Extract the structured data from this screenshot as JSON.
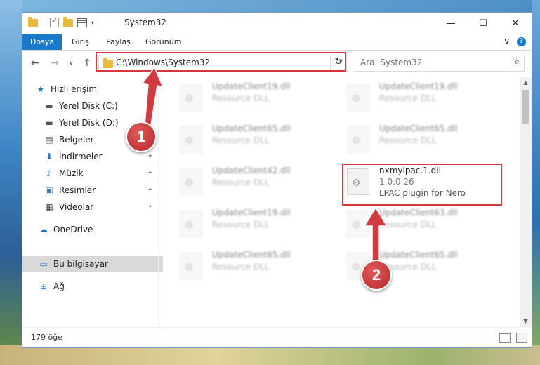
{
  "window": {
    "title": "System32",
    "minimize_glyph": "—",
    "maximize_glyph": "☐",
    "close_glyph": "✕"
  },
  "ribbon": {
    "tabs": [
      "Dosya",
      "Giriş",
      "Paylaş",
      "Görünüm"
    ],
    "expand_glyph": "∨",
    "help_glyph": "?"
  },
  "navigation": {
    "back_glyph": "←",
    "forward_glyph": "→",
    "recent_glyph": "∨",
    "up_glyph": "↑",
    "address_path": "C:\\Windows\\System32",
    "address_dropdown_glyph": "∨",
    "refresh_glyph": "↻",
    "search_placeholder": "Ara: System32",
    "search_glyph": "⌕"
  },
  "sidebar": {
    "items": [
      {
        "label": "Hızlı erişim",
        "icon": "star-icon",
        "glyph": "★",
        "pinned": false
      },
      {
        "label": "Yerel Disk (C:)",
        "icon": "drive-icon",
        "glyph": "▬",
        "pinned": true
      },
      {
        "label": "Yerel Disk (D:)",
        "icon": "drive-icon",
        "glyph": "▬",
        "pinned": true
      },
      {
        "label": "Belgeler",
        "icon": "documents-icon",
        "glyph": "▤",
        "pinned": true
      },
      {
        "label": "İndirmeler",
        "icon": "download-icon",
        "glyph": "⬇",
        "pinned": true
      },
      {
        "label": "Müzik",
        "icon": "music-icon",
        "glyph": "♪",
        "pinned": true
      },
      {
        "label": "Resimler",
        "icon": "pictures-icon",
        "glyph": "▣",
        "pinned": true
      },
      {
        "label": "Videolar",
        "icon": "video-icon",
        "glyph": "▦",
        "pinned": true
      },
      {
        "label": "OneDrive",
        "icon": "cloud-icon",
        "glyph": "☁",
        "pinned": false
      },
      {
        "label": "Bu bilgisayar",
        "icon": "computer-icon",
        "glyph": "▭",
        "pinned": false
      },
      {
        "label": "Ağ",
        "icon": "network-icon",
        "glyph": "⊞",
        "pinned": false
      }
    ],
    "pin_glyph": "📌"
  },
  "files": {
    "left_column": [
      {
        "name": "UpdateClient19.dll",
        "type": "Resource DLL"
      },
      {
        "name": "UpdateClient65.dll",
        "type": "Resource DLL"
      },
      {
        "name": "UpdateClient42.dll",
        "type": "Resource DLL"
      },
      {
        "name": "UpdateClient19.dll",
        "type": "Resource DLL"
      },
      {
        "name": "UpdateClient65.dll",
        "type": "Resource DLL"
      }
    ],
    "right_column": [
      {
        "name": "UpdateClient19.dll",
        "type": "Resource DLL"
      },
      {
        "name": "UpdateClient65.dll",
        "type": "Resource DLL"
      },
      {
        "name": "UpdateClient63.dll",
        "type": "Resource DLL"
      },
      {
        "name": "UpdateClient65.dll",
        "type": "Resource DLL"
      }
    ],
    "highlighted": {
      "name": "nxmylpac.1.dll",
      "version": "1.0.0.26",
      "description": "LPAC plugin for Nero"
    }
  },
  "status": {
    "item_count": "179 öğe"
  },
  "annotations": {
    "callout_1": "1",
    "callout_2": "2",
    "highlight_color": "#d9363e"
  }
}
